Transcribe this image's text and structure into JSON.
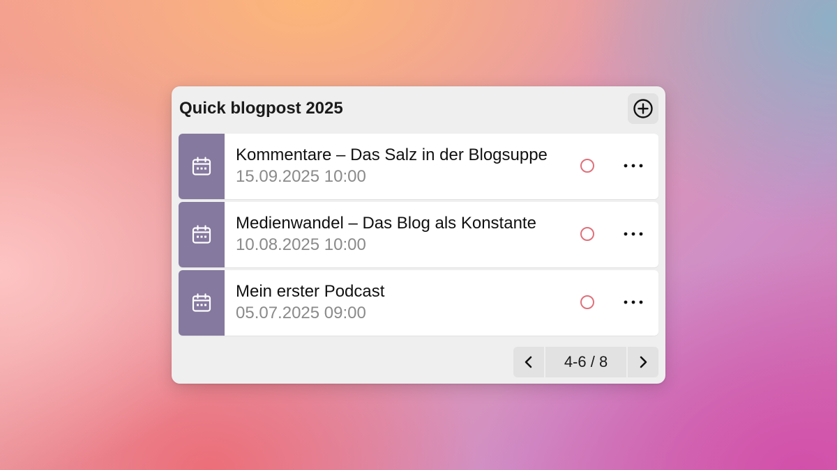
{
  "widget": {
    "title": "Quick blogpost 2025",
    "add_icon": "plus-circle-icon"
  },
  "items": [
    {
      "title": "Kommentare – Das Salz in der Blogsuppe",
      "date": "15.09.2025 10:00",
      "icon": "calendar-icon"
    },
    {
      "title": "Medienwandel – Das Blog als Konstante",
      "date": "10.08.2025 10:00",
      "icon": "calendar-icon"
    },
    {
      "title": "Mein erster Podcast",
      "date": "05.07.2025 09:00",
      "icon": "calendar-icon"
    }
  ],
  "pagination": {
    "label": "4-6 / 8",
    "prev_icon": "chevron-left-icon",
    "next_icon": "chevron-right-icon"
  },
  "colors": {
    "item_icon_bg": "#85799f",
    "status_circle": "#e0707a"
  }
}
